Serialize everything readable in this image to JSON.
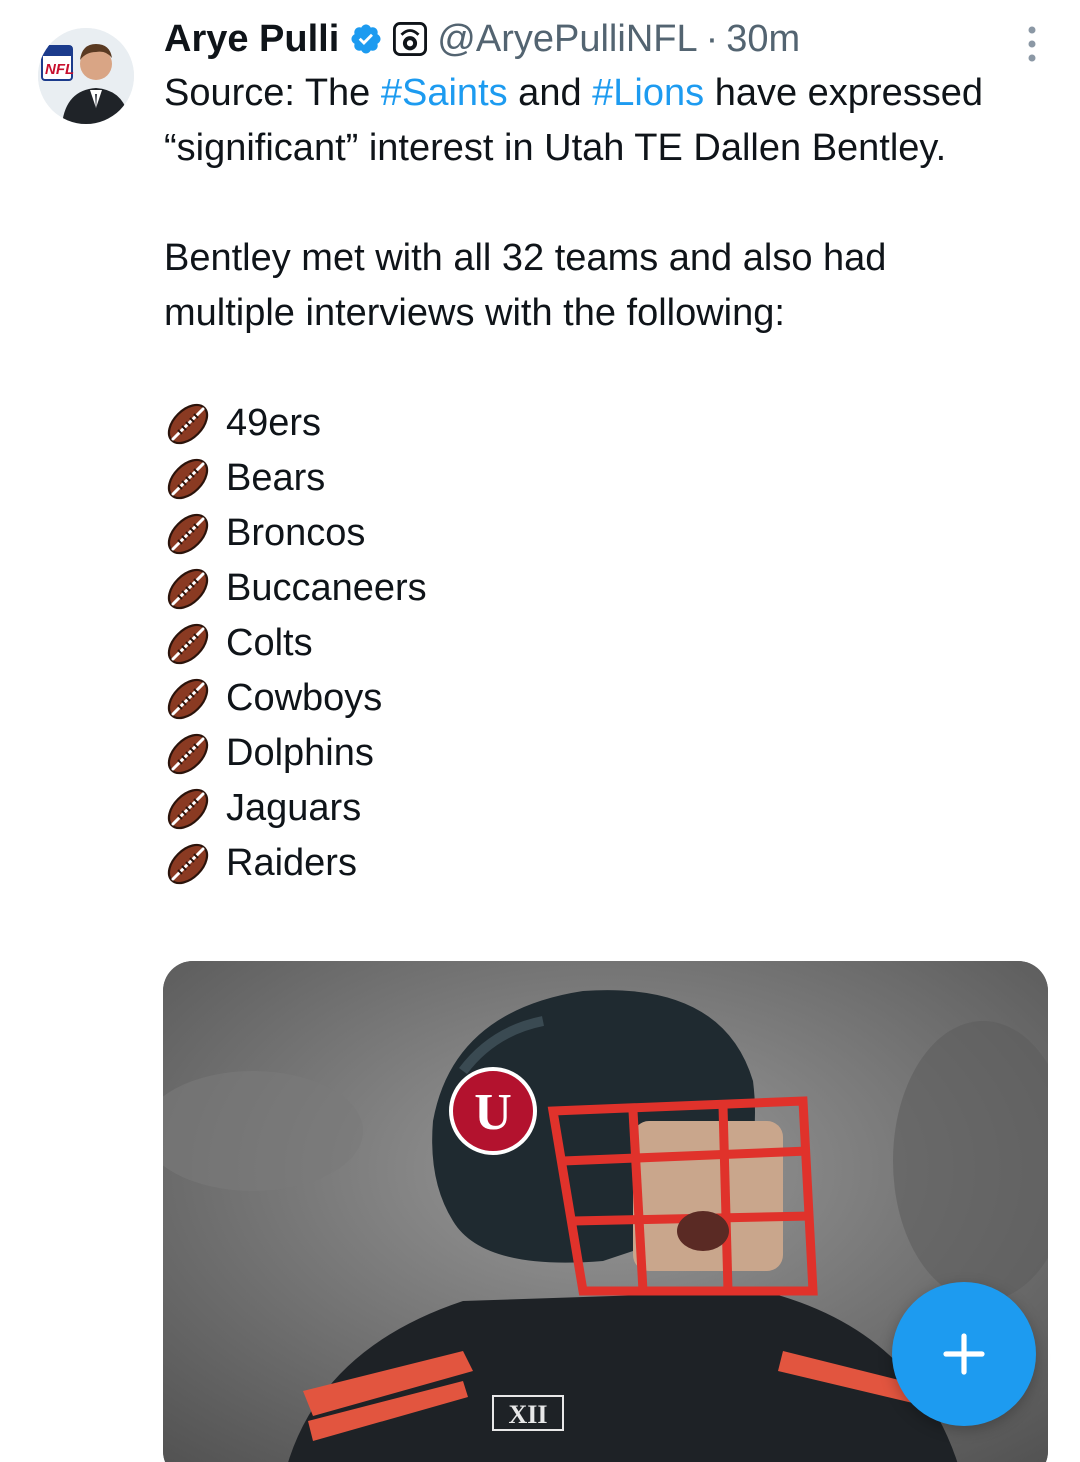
{
  "author": {
    "name": "Arye Pulli",
    "handle": "@AryePulliNFL",
    "separator": "·",
    "time": "30m"
  },
  "icons": {
    "avatar": "profile-photo",
    "verified": "verified-badge-icon",
    "affiliation": "affiliation-badge-icon",
    "more": "more-vertical-icon",
    "bullet": "american-football-emoji",
    "compose": "plus-icon"
  },
  "tweet": {
    "p1_prefix": "Source: The ",
    "hashtag1": "#Saints",
    "p1_mid": " and ",
    "hashtag2": "#Lions",
    "p1_suffix": " have expressed “significant” interest in Utah TE Dallen Bentley.",
    "p2": "Bentley met with all 32 teams and also had multiple interviews with the following:",
    "teams": [
      "49ers",
      "Bears",
      "Broncos",
      "Buccaneers",
      "Colts",
      "Cowboys",
      "Dolphins",
      "Jaguars",
      "Raiders"
    ]
  },
  "media": {
    "description_icon": "football-player-photo",
    "helmet_letter": "U",
    "jersey_patch": "XII"
  },
  "colors": {
    "accent": "#1d9bf0",
    "text": "#0f1419",
    "secondary": "#536471"
  }
}
